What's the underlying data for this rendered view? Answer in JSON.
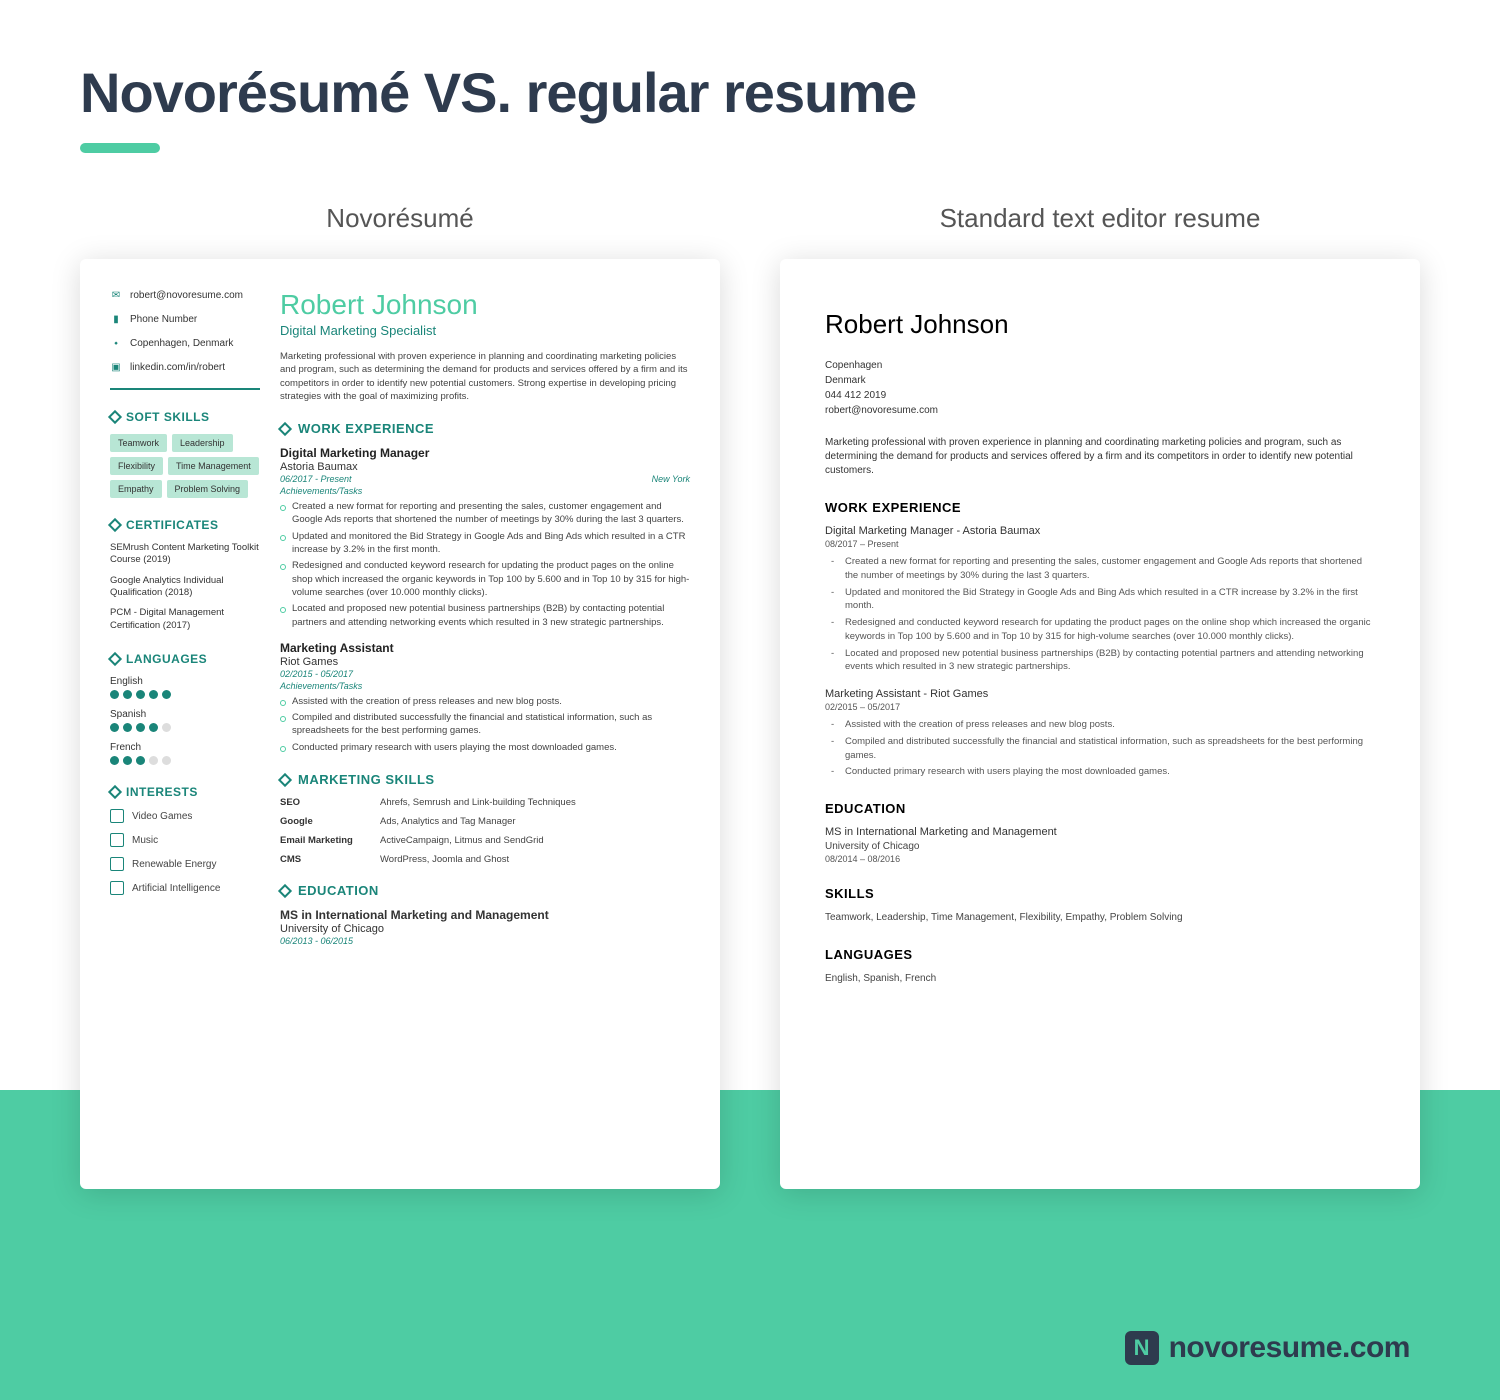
{
  "title": "Novorésumé VS. regular resume",
  "labels": {
    "novo": "Novorésumé",
    "std": "Standard text editor resume"
  },
  "footer": "novoresume.com",
  "person": {
    "name": "Robert Johnson",
    "role": "Digital Marketing Specialist",
    "summary": "Marketing professional with proven experience in planning and coordinating marketing policies and program, such as determining the demand for products and services offered by a firm and its competitors in order to identify new potential customers. Strong expertise in developing pricing strategies with the goal of maximizing profits.",
    "contact": {
      "email": "robert@novoresume.com",
      "phone": "Phone Number",
      "location": "Copenhagen, Denmark",
      "linkedin": "linkedin.com/in/robert"
    }
  },
  "softSkills": [
    "Teamwork",
    "Leadership",
    "Flexibility",
    "Time Management",
    "Empathy",
    "Problem Solving"
  ],
  "certificates": [
    "SEMrush Content Marketing Toolkit Course (2019)",
    "Google Analytics Individual Qualification (2018)",
    "PCM - Digital Management Certification (2017)"
  ],
  "languages": [
    {
      "name": "English",
      "level": 5
    },
    {
      "name": "Spanish",
      "level": 4
    },
    {
      "name": "French",
      "level": 3
    }
  ],
  "interests": [
    "Video Games",
    "Music",
    "Renewable Energy",
    "Artificial Intelligence"
  ],
  "headers": {
    "soft": "SOFT SKILLS",
    "cert": "CERTIFICATES",
    "lang": "LANGUAGES",
    "int": "INTERESTS",
    "work": "WORK EXPERIENCE",
    "mkt": "MARKETING SKILLS",
    "edu": "EDUCATION",
    "ach": "Achievements/Tasks"
  },
  "experience": [
    {
      "title": "Digital Marketing Manager",
      "company": "Astoria Baumax",
      "dates": "06/2017 - Present",
      "loc": "New York",
      "bullets": [
        "Created a new format for reporting and presenting the sales, customer engagement and Google Ads reports that shortened the number of meetings by 30% during the last 3 quarters.",
        "Updated and monitored the Bid Strategy in Google Ads and Bing Ads which resulted in a CTR increase by 3.2% in the first month.",
        "Redesigned and conducted keyword research for updating the product pages on the online shop which increased the organic keywords in Top 100 by 5.600 and in Top 10 by 315 for high-volume searches (over 10.000 monthly clicks).",
        "Located and proposed new potential business partnerships (B2B) by contacting potential partners and attending networking events which resulted in 3 new strategic partnerships."
      ]
    },
    {
      "title": "Marketing Assistant",
      "company": "Riot Games",
      "dates": "02/2015 - 05/2017",
      "loc": "",
      "bullets": [
        "Assisted with the creation of press releases and new blog posts.",
        "Compiled and distributed successfully the financial and statistical information, such as spreadsheets for the best performing games.",
        "Conducted primary research with users playing the most downloaded games."
      ]
    }
  ],
  "mktSkills": [
    {
      "k": "SEO",
      "v": "Ahrefs, Semrush and Link-building Techniques"
    },
    {
      "k": "Google",
      "v": "Ads, Analytics and Tag Manager"
    },
    {
      "k": "Email Marketing",
      "v": "ActiveCampaign, Litmus and SendGrid"
    },
    {
      "k": "CMS",
      "v": "WordPress, Joomla and Ghost"
    }
  ],
  "education": {
    "degree": "MS in International Marketing and Management",
    "school": "University of Chicago",
    "dates": "06/2013 - 06/2015"
  },
  "std": {
    "contact": {
      "city": "Copenhagen",
      "country": "Denmark",
      "phone": "044 412 2019",
      "email": "robert@novoresume.com"
    },
    "summary": "Marketing professional with proven experience in planning and coordinating marketing policies and program, such as determining the demand for products and services offered by a firm and its competitors in order to identify new potential customers.",
    "job1": "Digital Marketing Manager  - Astoria Baumax",
    "date1": "08/2017 – Present",
    "job2": "Marketing Assistant - Riot Games",
    "date2": "02/2015 – 05/2017",
    "eduSchool": "University of Chicago",
    "eduDate": "08/2014 – 08/2016",
    "skills": "Teamwork, Leadership, Time Management, Flexibility, Empathy, Problem Solving",
    "langs": "English, Spanish, French",
    "h": {
      "work": "WORK EXPERIENCE",
      "edu": "EDUCATION",
      "skills": "SKILLS",
      "lang": "LANGUAGES"
    }
  }
}
